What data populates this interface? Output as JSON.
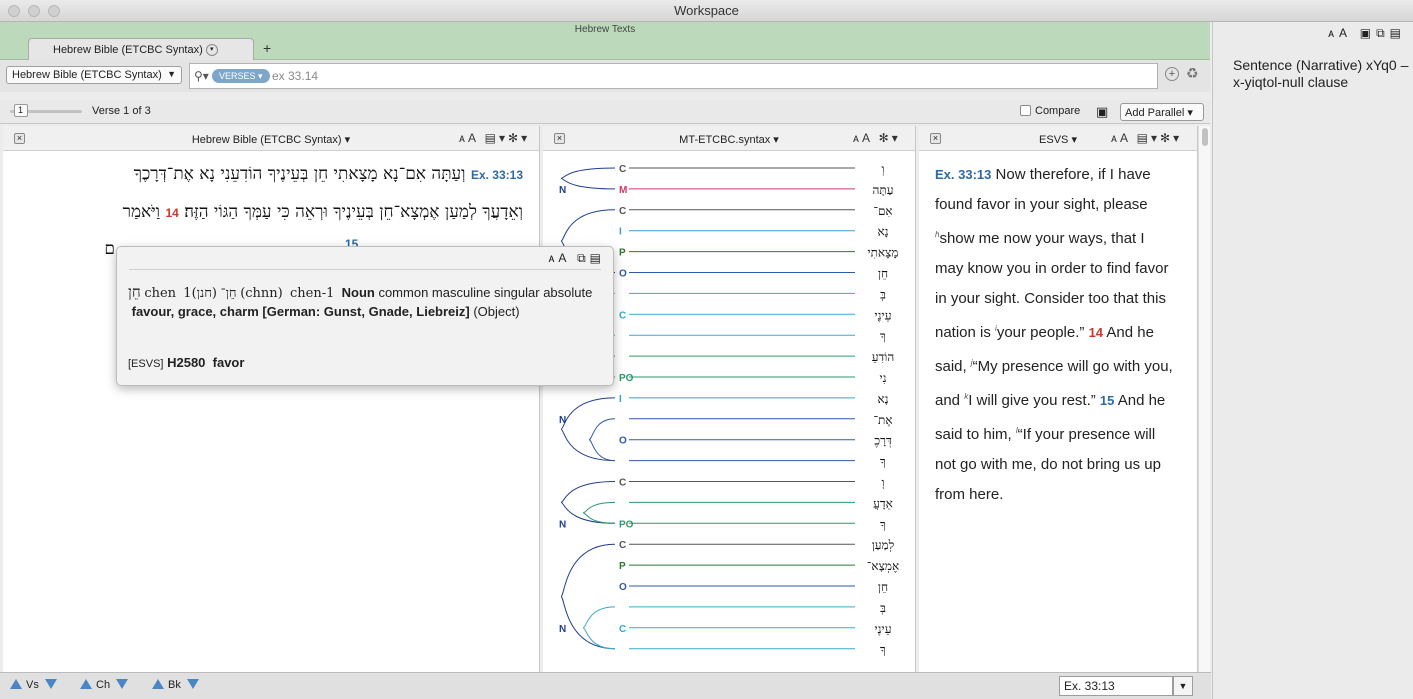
{
  "window": {
    "title": "Workspace"
  },
  "header": {
    "group_title": "Hebrew Texts",
    "doc_tab": "Hebrew Bible (ETCBC Syntax)",
    "add_tab": "+"
  },
  "search": {
    "resource": "Hebrew Bible (ETCBC Syntax)",
    "mode": "VERSES",
    "query": "ex 33.14"
  },
  "verse_nav": {
    "slider_value": "1",
    "verse_info": "Verse 1 of 3",
    "compare_label": "Compare",
    "add_parallel": "Add Parallel"
  },
  "panels": {
    "hebrew": {
      "title": "Hebrew Bible (ETCBC Syntax)",
      "ref": "Ex. 33:13",
      "line1": "וְעַתָּה אִם־נָא מָצָאתִי חֵן בְּעֵינֶיךָ הוֹדִעֵנִי נָא אֶת־דְּרָכֶךָ",
      "line2_a": "וְאֵדָעֲךָ לְמַעַן אֶמְצָא־חֵן בְּעֵינֶיךָ וּרְאֵה כִּי עַמְּךָ הַגּוֹי הַזֶּה׃",
      "vnum14": "14",
      "line2_b": "וַיֹּאמַר",
      "line3": "ם",
      "vnum15": "15"
    },
    "syntax": {
      "title": "MT-ETCBC.syntax"
    },
    "esvs": {
      "title": "ESVS",
      "ref": "Ex. 33:13",
      "t1": "Now therefore, if I have found favor in your sight, please ",
      "n1": "h",
      "t2": "show me now your ways, that I may know you in order to find favor in your sight. Consider too that this nation is ",
      "n2": "i",
      "t3": "your people.” ",
      "v14": "14",
      "t4": " And he said, ",
      "n3": "j",
      "t5": "“My presence will go with you, and ",
      "n4": "k",
      "t6": "I will give you rest.” ",
      "v15": "15",
      "t7": " And he said to him, ",
      "n5": "l",
      "t8": "“If your presence will not go with me, do not bring us up from here."
    }
  },
  "popup": {
    "hebrew": "חֵן",
    "translit": "chen",
    "lemma_id": "1חֵן־",
    "root": "(חנן)",
    "root_translit": "(chnn)",
    "lemma": "chen-1",
    "pos": "Noun",
    "morph": "common masculine singular absolute",
    "gloss": "favour, grace, charm [German: Gunst, Gnade, Liebreiz]",
    "role": "(Object)",
    "source": "[ESVS]",
    "strongs": "H2580",
    "english": "favor"
  },
  "sidebar": {
    "info": "Sentence (Narrative) xYq0 – x-yiqtol-null clause"
  },
  "bottom": {
    "vs": "Vs",
    "ch": "Ch",
    "bk": "Bk",
    "ref": "Ex. 33:13"
  },
  "syntax_rows": [
    {
      "label": "C",
      "color": "#555555",
      "heb": "וְ"
    },
    {
      "label": "M",
      "color": "#c83a6e",
      "heb": "עַתָּה"
    },
    {
      "label": "C",
      "color": "#555555",
      "heb": "אִם־"
    },
    {
      "label": "I",
      "color": "#3a9bd1",
      "heb": "נָא"
    },
    {
      "label": "P",
      "color": "#2a7a2a",
      "heb": "מָצָאתִי"
    },
    {
      "label": "O",
      "color": "#2f5aa8",
      "heb": "חֵן"
    },
    {
      "label": "",
      "color": "#3aa9c9",
      "heb": "בְּ"
    },
    {
      "label": "C",
      "color": "#3aa9c9",
      "heb": "עֵינֶי"
    },
    {
      "label": "",
      "color": "#3aa9c9",
      "heb": "ךָ"
    },
    {
      "label": "",
      "color": "#2a9a6a",
      "heb": "הוֹדִעֵ"
    },
    {
      "label": "PO",
      "color": "#2a9a6a",
      "heb": "נִי"
    },
    {
      "label": "I",
      "color": "#3a9bd1",
      "heb": "נָא"
    },
    {
      "label": "",
      "color": "#2f5aa8",
      "heb": "אֶת־"
    },
    {
      "label": "O",
      "color": "#2f5aa8",
      "heb": "דְּרָכֶ"
    },
    {
      "label": "",
      "color": "#2f5aa8",
      "heb": "ךָ"
    },
    {
      "label": "C",
      "color": "#555555",
      "heb": "וְ"
    },
    {
      "label": "",
      "color": "#2a9a6a",
      "heb": "אֵדָעֲ"
    },
    {
      "label": "PO",
      "color": "#2a9a6a",
      "heb": "ךָ"
    },
    {
      "label": "C",
      "color": "#555555",
      "heb": "לְמַעַן"
    },
    {
      "label": "P",
      "color": "#2a7a2a",
      "heb": "אֶמְצָא־"
    },
    {
      "label": "O",
      "color": "#2f5aa8",
      "heb": "חֵן"
    },
    {
      "label": "",
      "color": "#3aa9c9",
      "heb": "בְּ"
    },
    {
      "label": "C",
      "color": "#3aa9c9",
      "heb": "עֵינֶי"
    },
    {
      "label": "",
      "color": "#3aa9c9",
      "heb": "ךָ"
    }
  ]
}
